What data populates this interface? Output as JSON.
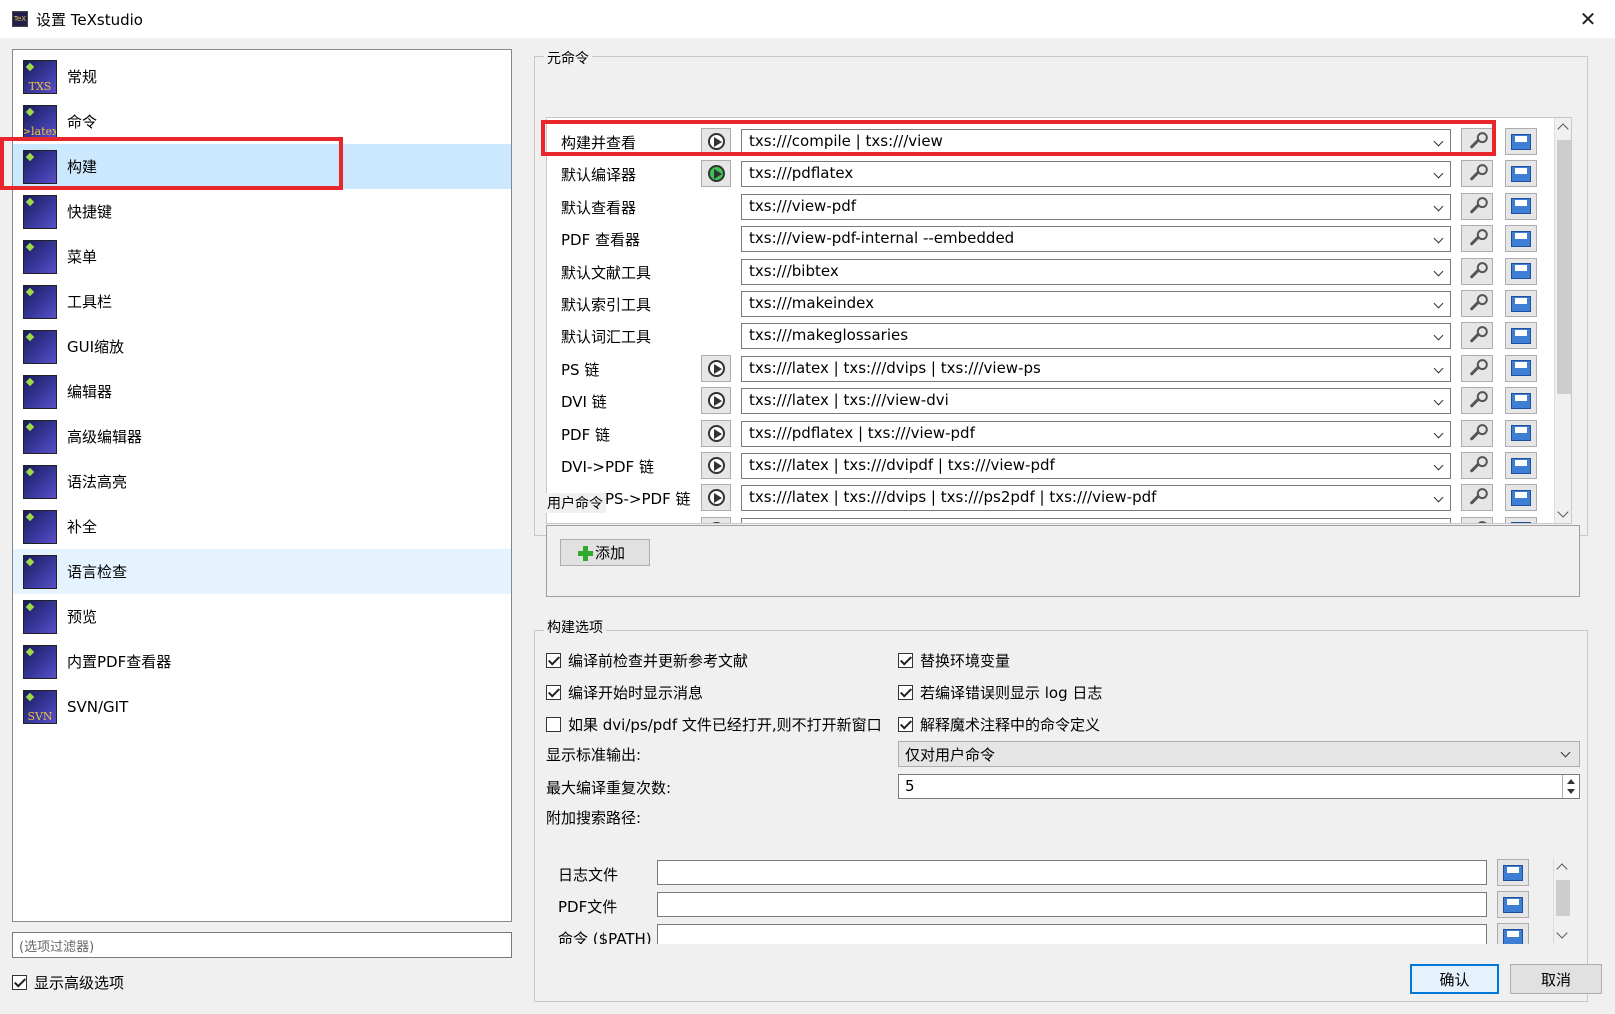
{
  "window": {
    "title": "设置 TeXstudio",
    "close_glyph": "✕"
  },
  "nav": {
    "items": [
      {
        "label": "常规",
        "icon": "txs-general-icon",
        "badge": "TXS"
      },
      {
        "label": "命令",
        "icon": "latex-commands-icon",
        "badge": ">latex"
      },
      {
        "label": "构建",
        "icon": "build-icon",
        "badge": ""
      },
      {
        "label": "快捷键",
        "icon": "keyboard-icon",
        "badge": ""
      },
      {
        "label": "菜单",
        "icon": "menu-icon",
        "badge": ""
      },
      {
        "label": "工具栏",
        "icon": "toolbar-icon",
        "badge": ""
      },
      {
        "label": "GUI缩放",
        "icon": "gui-scale-icon",
        "badge": ""
      },
      {
        "label": "编辑器",
        "icon": "editor-icon",
        "badge": ""
      },
      {
        "label": "高级编辑器",
        "icon": "advanced-editor-icon",
        "badge": ""
      },
      {
        "label": "语法高亮",
        "icon": "syntax-highlight-icon",
        "badge": ""
      },
      {
        "label": "补全",
        "icon": "completion-icon",
        "badge": ""
      },
      {
        "label": "语言检查",
        "icon": "language-check-icon",
        "badge": ""
      },
      {
        "label": "预览",
        "icon": "preview-icon",
        "badge": ""
      },
      {
        "label": "内置PDF查看器",
        "icon": "pdf-viewer-icon",
        "badge": ""
      },
      {
        "label": "SVN/GIT",
        "icon": "svn-git-icon",
        "badge": "SVN"
      }
    ],
    "selected_index": 2,
    "hovered_index": 11,
    "filter_placeholder": "(选项过滤器)",
    "show_advanced_label": "显示高级选项",
    "show_advanced_checked": true
  },
  "meta_commands": {
    "title": "元命令",
    "rows": [
      {
        "label": "构建并查看",
        "has_run": true,
        "run_active": false,
        "value": "txs:///compile | txs:///view"
      },
      {
        "label": "默认编译器",
        "has_run": true,
        "run_active": true,
        "value": "txs:///pdflatex"
      },
      {
        "label": "默认查看器",
        "has_run": false,
        "run_active": false,
        "value": "txs:///view-pdf"
      },
      {
        "label": "PDF 查看器",
        "has_run": false,
        "run_active": false,
        "value": "txs:///view-pdf-internal --embedded"
      },
      {
        "label": "默认文献工具",
        "has_run": false,
        "run_active": false,
        "value": "txs:///bibtex"
      },
      {
        "label": "默认索引工具",
        "has_run": false,
        "run_active": false,
        "value": "txs:///makeindex"
      },
      {
        "label": "默认词汇工具",
        "has_run": false,
        "run_active": false,
        "value": "txs:///makeglossaries"
      },
      {
        "label": "PS 链",
        "has_run": true,
        "run_active": false,
        "value": "txs:///latex | txs:///dvips | txs:///view-ps"
      },
      {
        "label": "DVI 链",
        "has_run": true,
        "run_active": false,
        "value": "txs:///latex | txs:///view-dvi"
      },
      {
        "label": "PDF 链",
        "has_run": true,
        "run_active": false,
        "value": "txs:///pdflatex | txs:///view-pdf"
      },
      {
        "label": "DVI->PDF 链",
        "has_run": true,
        "run_active": false,
        "value": "txs:///latex | txs:///dvipdf | txs:///view-pdf"
      },
      {
        "label": "DVI->PS->PDF 链",
        "has_run": true,
        "run_active": false,
        "value": "txs:///latex | txs:///dvips | txs:///ps2pdf | txs:///view-pdf"
      },
      {
        "label": "",
        "has_run": true,
        "run_active": false,
        "value": ""
      }
    ]
  },
  "user_commands": {
    "title": "用户命令",
    "add_label": "添加"
  },
  "build_options": {
    "title": "构建选项",
    "checks_left": [
      {
        "label": "编译前检查并更新参考文献",
        "checked": true
      },
      {
        "label": "编译开始时显示消息",
        "checked": true
      },
      {
        "label": "如果 dvi/ps/pdf 文件已经打开,则不打开新窗口",
        "checked": false
      }
    ],
    "checks_right": [
      {
        "label": "替换环境变量",
        "checked": true
      },
      {
        "label": "若编译错误则显示 log 日志",
        "checked": true
      },
      {
        "label": "解释魔术注释中的命令定义",
        "checked": true
      }
    ],
    "stdout_label": "显示标准输出:",
    "stdout_value": "仅对用户命令",
    "max_repeat_label": "最大编译重复次数:",
    "max_repeat_value": "5",
    "search_paths_label": "附加搜索路径:",
    "paths": [
      {
        "label": "日志文件",
        "value": ""
      },
      {
        "label": "PDF文件",
        "value": ""
      },
      {
        "label": "命令 ($PATH)",
        "value": ""
      }
    ]
  },
  "buttons": {
    "ok": "确认",
    "cancel": "取消"
  },
  "colors": {
    "selection": "#cce8ff",
    "hover": "#e5f3ff",
    "annotation_red": "#e8262c",
    "accent_blue": "#0078d7"
  }
}
